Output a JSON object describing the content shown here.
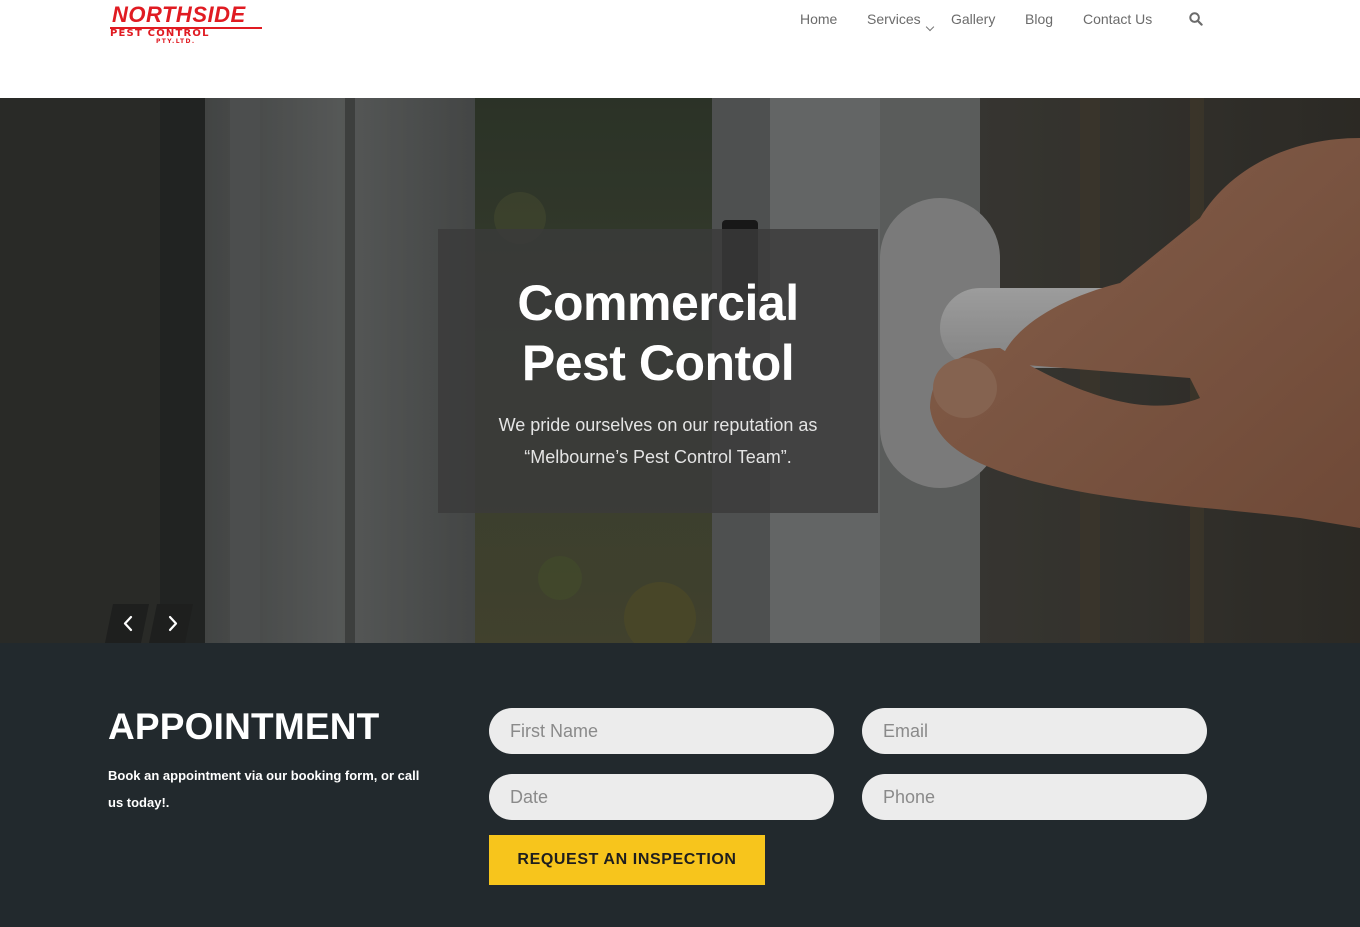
{
  "brand": {
    "name": "NORTHSIDE",
    "line2": "PEST CONTROL",
    "line3": "PTY.LTD.",
    "color": "#e01b22"
  },
  "nav": {
    "items": [
      {
        "label": "Home"
      },
      {
        "label": "Services",
        "has_dropdown": true
      },
      {
        "label": "Gallery"
      },
      {
        "label": "Blog"
      },
      {
        "label": "Contact Us"
      }
    ],
    "search_icon": "search-icon"
  },
  "hero": {
    "title_line1": "Commercial",
    "title_line2": "Pest Contol",
    "subtitle_line1": "We pride ourselves on our reputation as",
    "subtitle_line2": "“Melbourne’s Pest Control Team”.",
    "prev_icon": "chevron-left-icon",
    "next_icon": "chevron-right-icon"
  },
  "appointment": {
    "title": "APPOINTMENT",
    "description": "Book an appointment via our booking form, or call us today!.",
    "fields": {
      "first_name": {
        "placeholder": "First Name",
        "value": ""
      },
      "email": {
        "placeholder": "Email",
        "value": ""
      },
      "date": {
        "placeholder": "Date",
        "value": ""
      },
      "phone": {
        "placeholder": "Phone",
        "value": ""
      }
    },
    "submit_label": "REQUEST AN INSPECTION"
  },
  "colors": {
    "accent": "#f7c51c",
    "dark_section": "#22292d",
    "nav_text": "#6b6b6b"
  }
}
